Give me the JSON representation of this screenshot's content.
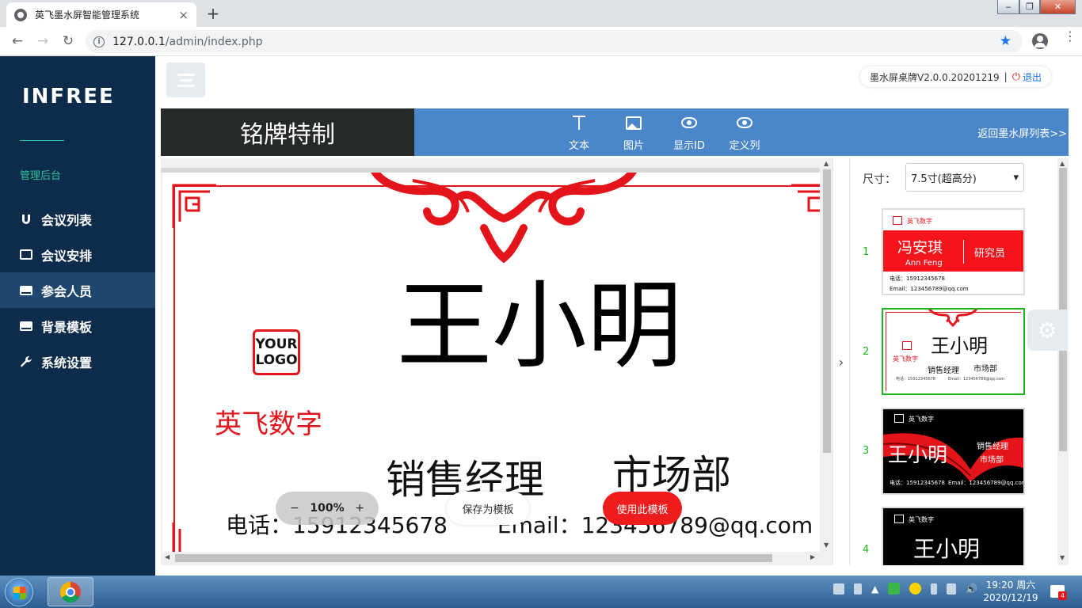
{
  "browser": {
    "tab_title": "英飞墨水屏智能管理系统",
    "tab_close": "×",
    "new_tab": "+",
    "url_host": "127.0.0.1",
    "url_path": "/admin/index.php",
    "back": "←",
    "forward": "→",
    "reload": "↻",
    "star": "★",
    "menu": "⋮",
    "win_min": "‒",
    "win_max": "❐",
    "win_close": "✕"
  },
  "sidebar": {
    "logo": "INFREE",
    "caption": "管理后台",
    "items": [
      {
        "label": "会议列表",
        "icon": "magnet-icon"
      },
      {
        "label": "会议安排",
        "icon": "cc-icon"
      },
      {
        "label": "参会人员",
        "icon": "drive-icon",
        "active": true
      },
      {
        "label": "背景模板",
        "icon": "drive-icon"
      },
      {
        "label": "系统设置",
        "icon": "wrench-icon"
      }
    ]
  },
  "header": {
    "version": "墨水屏桌牌V2.0.0.20201219",
    "separator": "|",
    "logout": "退出"
  },
  "editor": {
    "title": "铭牌特制",
    "tools": [
      {
        "label": "文本",
        "icon": "text-icon"
      },
      {
        "label": "图片",
        "icon": "image-icon"
      },
      {
        "label": "显示ID",
        "icon": "eye-icon"
      },
      {
        "label": "定义列",
        "icon": "eye-icon"
      }
    ],
    "back_link": "返回墨水屏列表>>",
    "zoom": "100%",
    "zoom_minus": "−",
    "zoom_plus": "+",
    "save_template": "保存为模板",
    "use_template": "使用此模板",
    "collapse": "›"
  },
  "badge": {
    "logo_line1": "YOUR",
    "logo_line2": "LOGO",
    "company": "英飞数字",
    "name": "王小明",
    "title": "销售经理",
    "department": "市场部",
    "phone_label": "电话：",
    "phone": "15912345678",
    "email_label": "Email：",
    "email": "123456789@qq.com"
  },
  "right_panel": {
    "size_label": "尺寸：",
    "size_value": "7.5寸(超高分)",
    "size_caret": "▾",
    "templates": [
      {
        "num": "1",
        "company": "英飞数字",
        "name": "冯安琪",
        "name_en": "Ann Feng",
        "title": "研究员",
        "phone": "电话：15912345678",
        "email": "Email：123456789@qq.com"
      },
      {
        "num": "2",
        "company": "英飞数字",
        "name": "王小明",
        "title": "销售经理",
        "dept": "市场部",
        "phone": "电话：15912345678",
        "email": "Email：123456789@qq.com"
      },
      {
        "num": "3",
        "company": "英飞数字",
        "name": "王小明",
        "title": "销售经理",
        "dept": "市场部",
        "phone": "电话：15912345678",
        "email": "Email：123456789@qq.com"
      },
      {
        "num": "4",
        "company": "英飞数字",
        "name": "王小明"
      }
    ]
  },
  "taskbar": {
    "time": "19:20 周六",
    "date": "2020/12/19",
    "notif_count": "4"
  },
  "colors": {
    "sidebar_bg": "#0d2b4a",
    "accent_green": "#2fc5a0",
    "toolbar_blue": "#4a86c8",
    "badge_red": "#e4141b",
    "selected_green": "#1db51d"
  }
}
